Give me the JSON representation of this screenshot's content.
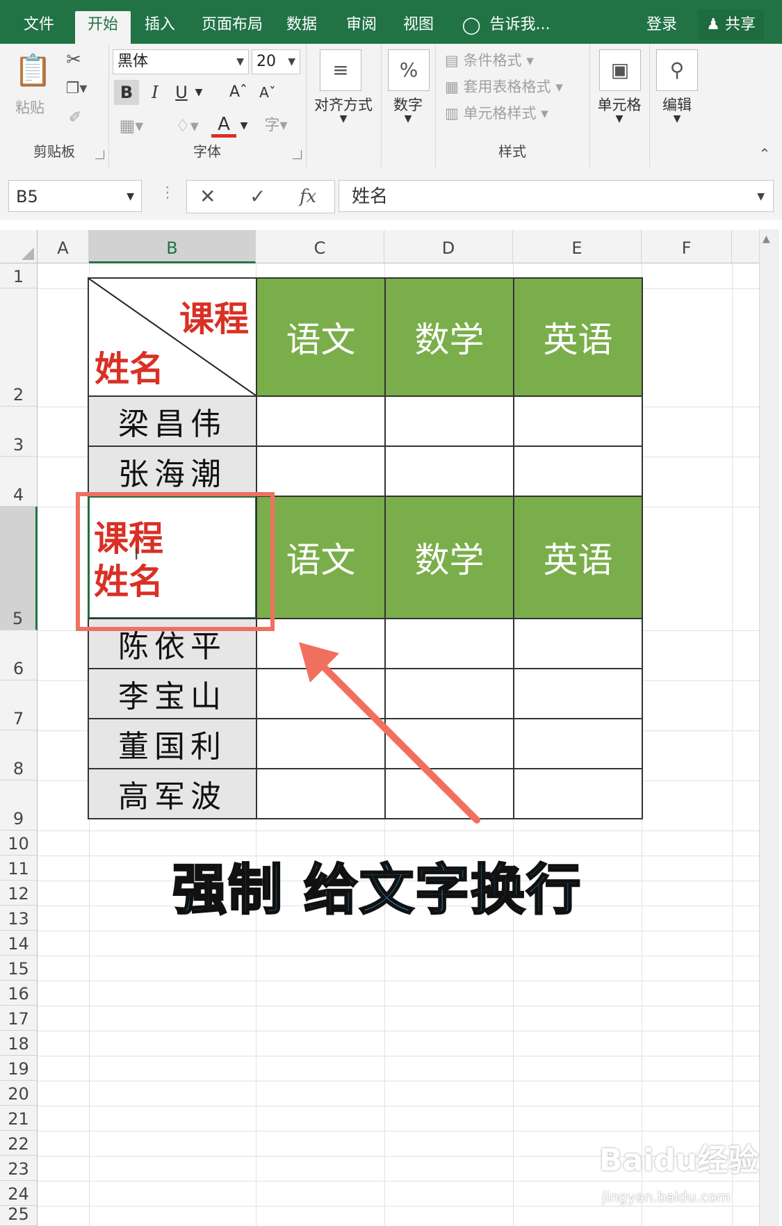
{
  "menu": {
    "tabs": [
      "文件",
      "开始",
      "插入",
      "页面布局",
      "数据",
      "审阅",
      "视图"
    ],
    "tell_me": "告诉我...",
    "login": "登录",
    "share": "共享"
  },
  "ribbon": {
    "clipboard": {
      "label": "剪贴板",
      "paste": "粘贴"
    },
    "font": {
      "label": "字体",
      "font_name": "黑体",
      "font_size": "20",
      "bold": "B",
      "italic": "I",
      "underline": "U",
      "font_color_glyph": "A"
    },
    "align": {
      "label": "对齐方式"
    },
    "number": {
      "label": "数字",
      "glyph": "%"
    },
    "styles": {
      "label": "样式",
      "conditional": "条件格式",
      "table_format": "套用表格格式",
      "cell_styles": "单元格样式"
    },
    "cells": {
      "label": "单元格"
    },
    "editing": {
      "label": "编辑"
    }
  },
  "formula": {
    "name_box": "B5",
    "content": "姓名",
    "fx": "fx"
  },
  "columns": [
    "A",
    "B",
    "C",
    "D",
    "E",
    "F"
  ],
  "rows": [
    "1",
    "2",
    "3",
    "4",
    "5",
    "6",
    "7",
    "8",
    "9",
    "10",
    "11",
    "12",
    "13",
    "14",
    "15",
    "16",
    "17",
    "18",
    "19",
    "20",
    "21",
    "22",
    "23",
    "24",
    "25"
  ],
  "table": {
    "header_course": "课程",
    "header_name": "姓名",
    "subjects": [
      "语文",
      "数学",
      "英语"
    ],
    "students_a": [
      "梁昌伟",
      "张海潮"
    ],
    "students_b": [
      "陈依平",
      "李宝山",
      "董国利",
      "高军波"
    ]
  },
  "caption": "强制 给文字换行",
  "watermark": {
    "logo": "Baidu经验",
    "url": "jingyan.baidu.com"
  },
  "colors": {
    "excel_green": "#217346",
    "header_green": "#7aae4a",
    "red_text": "#d93025",
    "highlight": "#f07060",
    "caption_blue": "#2ba3e0"
  }
}
